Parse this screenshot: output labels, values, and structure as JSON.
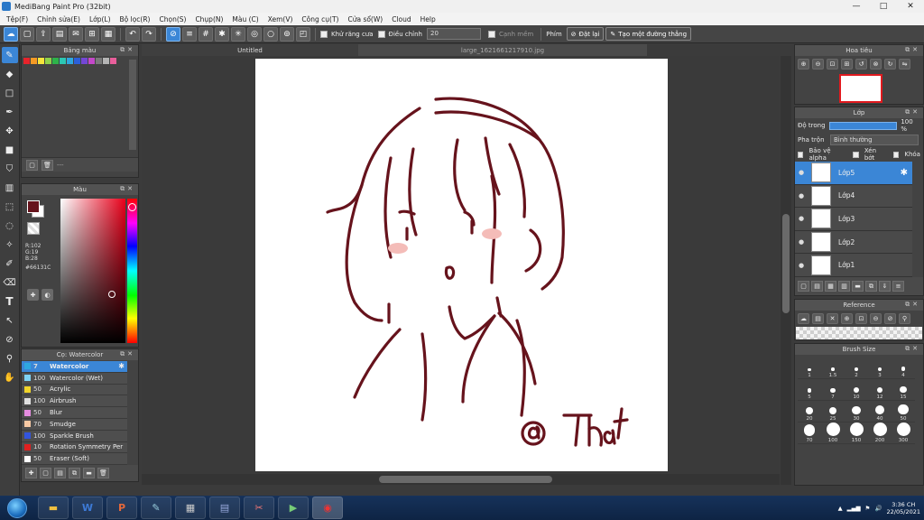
{
  "window": {
    "title": "MediBang Paint Pro (32bit)",
    "minimize": "—",
    "maximize": "□",
    "close": "✕"
  },
  "menu": [
    "Tệp(F)",
    "Chỉnh sửa(E)",
    "Lớp(L)",
    "Bộ lọc(R)",
    "Chọn(S)",
    "Chụp(N)",
    "Màu (C)",
    "Xem(V)",
    "Công cụ(T)",
    "Cửa sổ(W)",
    "Cloud",
    "Help"
  ],
  "toolbar": {
    "antialias_label": "Khử răng cưa",
    "correction_label": "Điều chỉnh",
    "correction_value": "20",
    "edge_label": "Cạnh mềm",
    "keys_label": "Phím",
    "reset_label": "Đặt lại",
    "ruler_label": "Tạo một đường thẳng"
  },
  "tabs": {
    "doc1": "Untitled",
    "doc2": "large_1621661217910.jpg"
  },
  "palette": {
    "title": "Bảng màu",
    "swatches": [
      "#e8242b",
      "#f59a25",
      "#f7e43b",
      "#8fd24a",
      "#2db34a",
      "#2cc7b4",
      "#2ea7e0",
      "#2b5fd9",
      "#7447d6",
      "#c448c9",
      "#7a7a7a",
      "#b5b5b5",
      "#e95f9b"
    ],
    "empty_text": "---"
  },
  "color": {
    "title": "Màu",
    "fg": "#66131C",
    "rgb_text": "R:102 G:19 B:28",
    "hex_text": "#66131C"
  },
  "brush": {
    "title": "Cọ: Watercolor",
    "items": [
      {
        "size": "7",
        "name": "Watercolor",
        "color": "#2ea7e0"
      },
      {
        "size": "100",
        "name": "Watercolor (Wet)",
        "color": "#7fd3f5"
      },
      {
        "size": "50",
        "name": "Acrylic",
        "color": "#f1d52b"
      },
      {
        "size": "100",
        "name": "Airbrush",
        "color": "#e0e0e0"
      },
      {
        "size": "50",
        "name": "Blur",
        "color": "#e58ce0"
      },
      {
        "size": "70",
        "name": "Smudge",
        "color": "#f8c9a4"
      },
      {
        "size": "100",
        "name": "Sparkle Brush",
        "color": "#3355dd"
      },
      {
        "size": "10",
        "name": "Rotation Symmetry Per",
        "color": "#e02020"
      },
      {
        "size": "50",
        "name": "Eraser (Soft)",
        "color": "#ffffff"
      }
    ]
  },
  "navigator": {
    "title": "Hoa tiêu"
  },
  "layers": {
    "title": "Lớp",
    "opacity_label": "Độ trong",
    "opacity_value": "100 %",
    "opacity_fraction": 1.0,
    "blend_label": "Pha trộn",
    "blend_value": "Bình thường",
    "protect_alpha": "Bảo vệ alpha",
    "clipping": "Xén bớt",
    "lock": "Khóa",
    "items": [
      {
        "name": "Lớp5",
        "selected": true
      },
      {
        "name": "Lớp4",
        "selected": false
      },
      {
        "name": "Lớp3",
        "selected": false
      },
      {
        "name": "Lớp2",
        "selected": false
      },
      {
        "name": "Lớp1",
        "selected": false
      }
    ]
  },
  "reference": {
    "title": "Reference"
  },
  "brush_size": {
    "title": "Brush Size",
    "sizes": [
      "1",
      "1.5",
      "2",
      "3",
      "4",
      "5",
      "7",
      "10",
      "12",
      "15",
      "20",
      "25",
      "30",
      "40",
      "50",
      "70",
      "100",
      "150",
      "200",
      "300"
    ]
  },
  "canvas_signature": "@ Thắt",
  "taskbar": {
    "time": "3:36 CH",
    "date": "22/05/2021"
  }
}
